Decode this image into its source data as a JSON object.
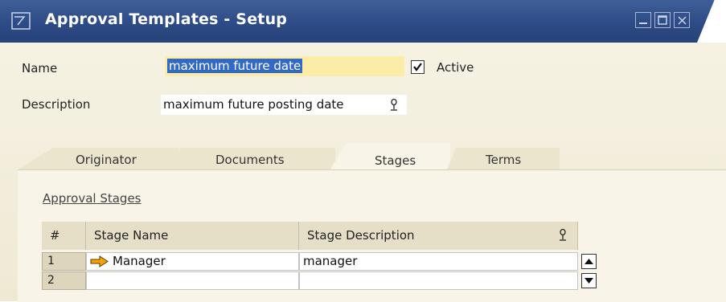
{
  "window": {
    "title": "Approval Templates - Setup",
    "controls": [
      "minimize",
      "maximize",
      "close"
    ]
  },
  "form": {
    "name_label": "Name",
    "name_value": "maximum future date",
    "active_label": "Active",
    "active_checked": true,
    "description_label": "Description",
    "description_value": "maximum future posting date"
  },
  "tabs": [
    {
      "label": "Originator",
      "active": false
    },
    {
      "label": "Documents",
      "active": false
    },
    {
      "label": "Stages",
      "active": true
    },
    {
      "label": "Terms",
      "active": false
    }
  ],
  "stages": {
    "section_title": "Approval Stages",
    "columns": [
      "#",
      "Stage Name",
      "Stage Description"
    ],
    "rows": [
      {
        "num": "1",
        "name": "Manager",
        "description": "manager"
      },
      {
        "num": "2",
        "name": "",
        "description": ""
      }
    ]
  },
  "colors": {
    "titlebar": "#2d4b86",
    "form_background": "#f3eedb",
    "name_field": "#fbeca8",
    "selection": "#3169c6",
    "arrow": "#f5a300"
  }
}
